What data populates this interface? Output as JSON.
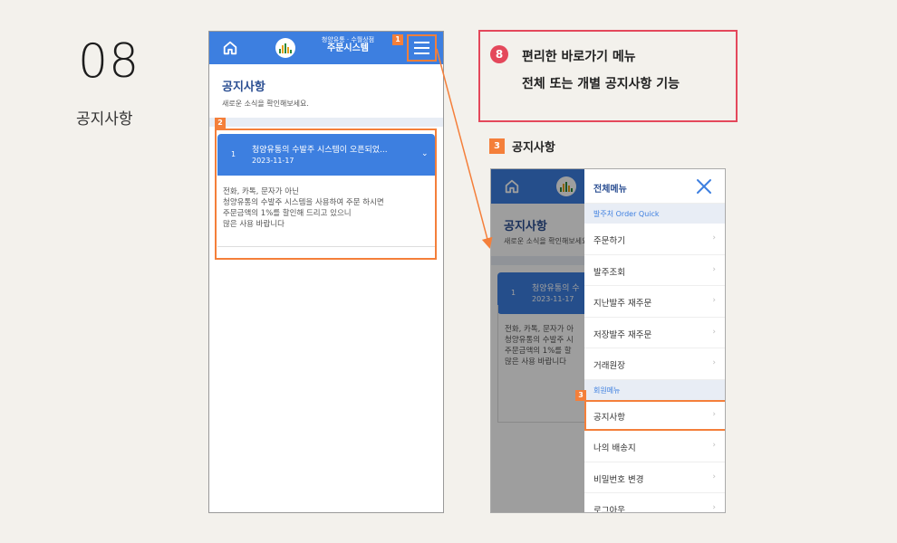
{
  "step": {
    "number": "08",
    "title": "공지사항"
  },
  "app": {
    "brand_line1": "청양유통 · 수월상점",
    "brand_line2": "주문시스템"
  },
  "notice_page": {
    "title": "공지사항",
    "subtitle": "새로운 소식을 확인해보세요.",
    "item": {
      "number": "1",
      "title": "청양유통의 수발주 시스템이 오픈되었...",
      "date": "2023-11-17",
      "body_lines": [
        "전화, 카톡, 문자가 아닌",
        "청양유통의 수발주 시스템을 사용하여 주문 하시면",
        "주문금액의 1%를 할인해 드리고 있으니",
        "많은 사용 바랍니다"
      ]
    }
  },
  "phone2_preview": {
    "title": "공지사항",
    "subtitle": "새로운 소식을 확인해보세요.",
    "item_number": "1",
    "item_title": "청양유통의 수",
    "item_date": "2023-11-17",
    "body_lines": [
      "전화, 카톡, 문자가 아",
      "청양유통의 수발주 시",
      "주문금액의 1%를 할",
      "많은 사용 바랍니다"
    ]
  },
  "badges": {
    "b1": "1",
    "b2": "2",
    "b3": "3"
  },
  "callout": {
    "number": "8",
    "line1": "편리한 바로가기 메뉴",
    "line2": "전체 또는 개별 공지사항 기능"
  },
  "sub_label": {
    "number": "3",
    "text": "공지사항"
  },
  "drawer": {
    "title": "전체메뉴",
    "section1": "발주처 Order Quick",
    "section1_items": [
      "주문하기",
      "발주조회",
      "지난발주 재주문",
      "저장발주 재주문",
      "거래원장"
    ],
    "section2": "회원메뉴",
    "section2_items": [
      "공지사항",
      "나의 배송지",
      "비밀번호 변경",
      "로그아웃"
    ],
    "arrow": "›"
  },
  "colors": {
    "primary": "#3d7fe0",
    "highlight": "#f47f3a",
    "callout": "#e4485b"
  }
}
